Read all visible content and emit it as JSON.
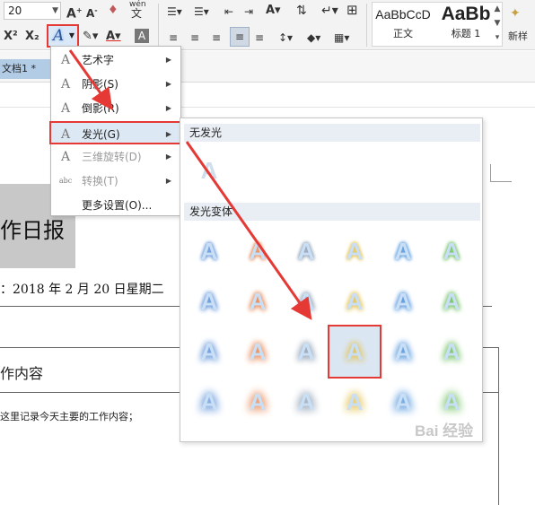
{
  "ribbon": {
    "font_size": "20",
    "superscript": "X²",
    "subscript": "X₂",
    "text_effect_label": "A",
    "pinyin_top": "wén",
    "pinyin_bottom": "文",
    "styles": [
      {
        "preview": "AaBbCcD",
        "name": "正文"
      },
      {
        "preview": "AaBb",
        "name": "标题 1"
      }
    ],
    "new_style": "新样"
  },
  "tabs": {
    "document": "文档1 *"
  },
  "document": {
    "title": "作日报",
    "date_line": "：2018 年 2 月 20 日星期二",
    "section_title": "作内容",
    "body_line": "这里记录今天主要的工作内容；"
  },
  "menu": {
    "items": [
      {
        "icon": "A",
        "label": "艺术字",
        "has_sub": true,
        "disabled": false
      },
      {
        "icon": "A",
        "label": "阴影(S)",
        "has_sub": true,
        "disabled": false
      },
      {
        "icon": "A",
        "label": "倒影(R)",
        "has_sub": true,
        "disabled": false
      },
      {
        "icon": "A",
        "label": "发光(G)",
        "has_sub": true,
        "disabled": false,
        "selected": true
      },
      {
        "icon": "A",
        "label": "三维旋转(D)",
        "has_sub": true,
        "disabled": true
      },
      {
        "icon": "abc",
        "label": "转换(T)",
        "has_sub": true,
        "disabled": true
      },
      {
        "icon": "",
        "label": "更多设置(O)...",
        "has_sub": false,
        "disabled": false
      }
    ]
  },
  "submenu": {
    "no_glow_header": "无发光",
    "variants_header": "发光变体",
    "glow_colors": [
      "#5b8fd6",
      "#e6824b",
      "#8a9bb0",
      "#e3c04a",
      "#4a90d9",
      "#6bbf59"
    ],
    "selected": {
      "row": 3,
      "col": 4
    }
  },
  "watermark": "Bai 经验",
  "colors": {
    "highlight_border": "#e53935",
    "arrow": "#e53935",
    "accent": "#2b5797"
  }
}
